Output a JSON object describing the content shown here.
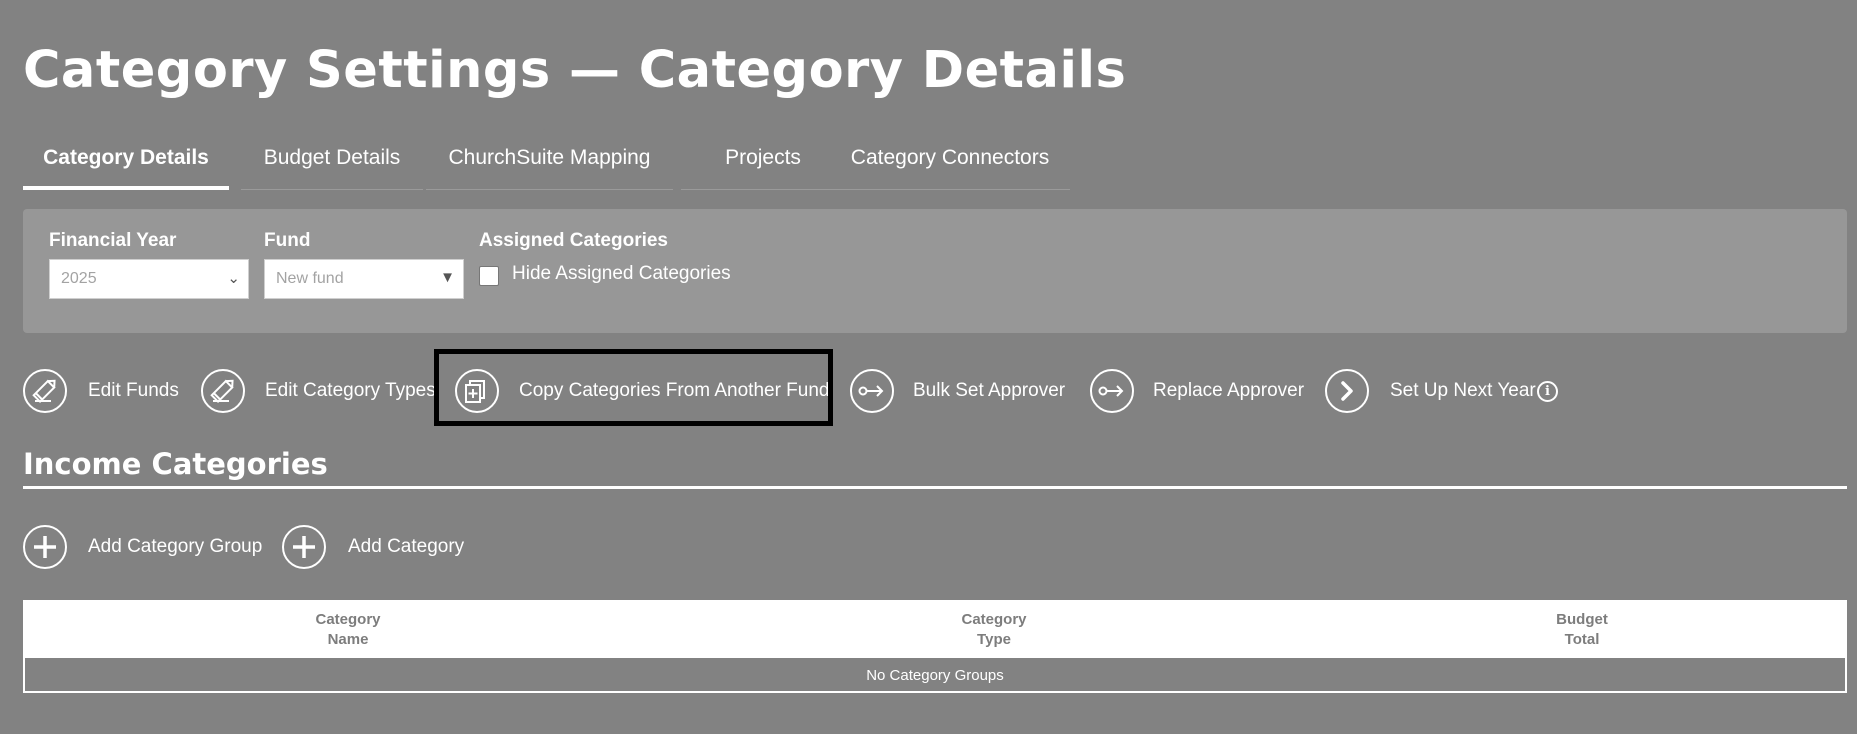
{
  "page": {
    "title": "Category Settings — Category Details"
  },
  "tabs": [
    {
      "label": "Category Details",
      "active": true
    },
    {
      "label": "Budget Details",
      "active": false
    },
    {
      "label": "ChurchSuite Mapping",
      "active": false
    },
    {
      "label": "Projects",
      "active": false
    },
    {
      "label": "Category Connectors",
      "active": false
    }
  ],
  "filters": {
    "financial_year": {
      "label": "Financial Year",
      "value": "2025"
    },
    "fund": {
      "label": "Fund",
      "value": "New fund"
    },
    "assigned": {
      "label": "Assigned Categories",
      "checkbox_label": "Hide Assigned Categories",
      "checked": false
    }
  },
  "actions": [
    {
      "label": "Edit Funds",
      "icon": "pencil-icon"
    },
    {
      "label": "Edit Category Types",
      "icon": "pencil-icon"
    },
    {
      "label": "Copy Categories From Another Fund",
      "icon": "copy-icon"
    },
    {
      "label": "Bulk Set Approver",
      "icon": "key-arrow-icon"
    },
    {
      "label": "Replace Approver",
      "icon": "key-arrow-icon"
    },
    {
      "label": "Set Up Next Year",
      "icon": "chevron-right-icon",
      "info": "i"
    }
  ],
  "income": {
    "title": "Income Categories",
    "add_group_label": "Add Category Group",
    "add_category_label": "Add Category",
    "table": {
      "columns": [
        {
          "line1": "Category",
          "line2": "Name"
        },
        {
          "line1": "Category",
          "line2": "Type"
        },
        {
          "line1": "Budget",
          "line2": "Total"
        }
      ],
      "empty_message": "No Category Groups"
    }
  },
  "colors": {
    "background": "#828282",
    "panel": "#979797",
    "highlight_border": "#000000",
    "text": "#ffffff"
  }
}
